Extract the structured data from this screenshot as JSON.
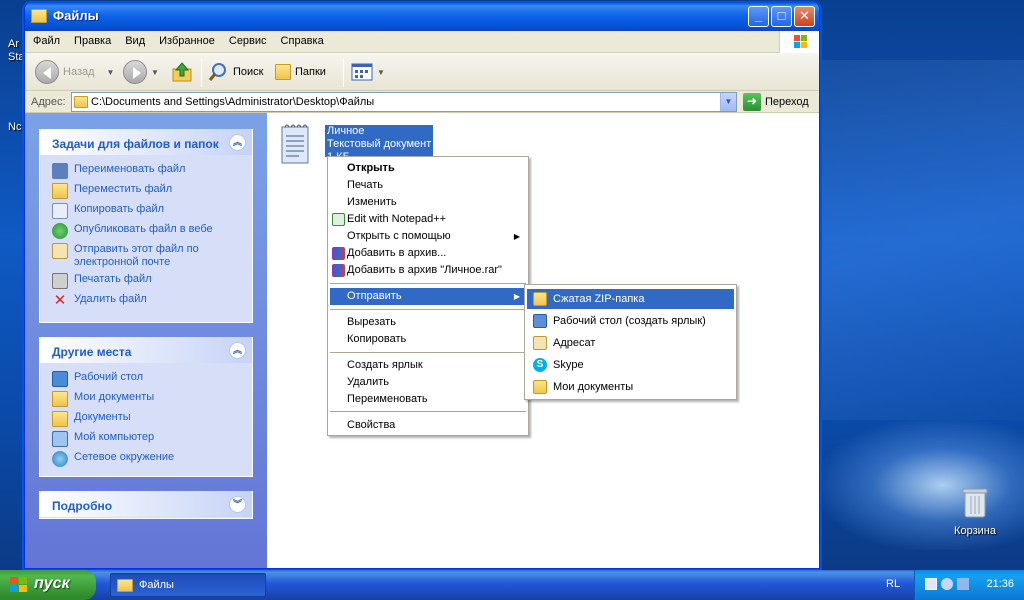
{
  "desktop": {
    "left_label_1": "Ar",
    "left_label_2": "Sta",
    "left_label_3": "Nc",
    "recycle_bin": "Корзина"
  },
  "window": {
    "title": "Файлы",
    "controls": {
      "minimize": "_",
      "maximize": "□",
      "close": "✕"
    }
  },
  "menubar": {
    "items": [
      "Файл",
      "Правка",
      "Вид",
      "Избранное",
      "Сервис",
      "Справка"
    ]
  },
  "toolbar": {
    "back": "Назад",
    "search": "Поиск",
    "folders": "Папки"
  },
  "address": {
    "label": "Адрес:",
    "value": "C:\\Documents and Settings\\Administrator\\Desktop\\Файлы",
    "go": "Переход"
  },
  "tasks_panel": {
    "title": "Задачи для файлов и папок",
    "items": [
      "Переименовать файл",
      "Переместить файл",
      "Копировать файл",
      "Опубликовать файл в вебе",
      "Отправить этот файл по электронной почте",
      "Печатать файл",
      "Удалить файл"
    ]
  },
  "places_panel": {
    "title": "Другие места",
    "items": [
      "Рабочий стол",
      "Мои документы",
      "Документы",
      "Мой компьютер",
      "Сетевое окружение"
    ]
  },
  "details_panel": {
    "title": "Подробно"
  },
  "file": {
    "name": "Личное",
    "type": "Текстовый документ",
    "size": "1 КБ"
  },
  "context_menu": {
    "items": [
      "Открыть",
      "Печать",
      "Изменить",
      "Edit with Notepad++",
      "Открыть с помощью",
      "Добавить в архив...",
      "Добавить в архив \"Личное.rar\"",
      "Отправить",
      "Вырезать",
      "Копировать",
      "Создать ярлык",
      "Удалить",
      "Переименовать",
      "Свойства"
    ]
  },
  "send_to_menu": {
    "items": [
      "Сжатая ZIP-папка",
      "Рабочий стол (создать ярлык)",
      "Адресат",
      "Skype",
      "Мои документы"
    ]
  },
  "taskbar": {
    "start": "пуск",
    "task": "Файлы",
    "lang": "RL",
    "clock": "21:36"
  }
}
